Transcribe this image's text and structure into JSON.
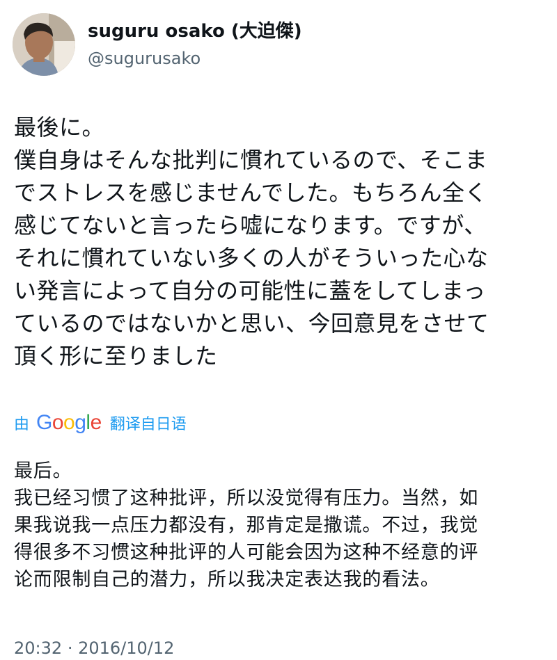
{
  "author": {
    "display_name": "suguru osako (大迫傑)",
    "handle": "@sugurusako",
    "avatar_icon": "profile-photo"
  },
  "tweet": {
    "text_original": "最後に。\n僕自身はそんな批判に慣れているので、そこまでストレスを感じませんでした。もちろん全く感じてないと言ったら嘘になります。ですが、それに慣れていない多くの人がそういった心ない発言によって自分の可能性に蓋をしてしまっているのではないかと思い、今回意見をさせて頂く形に至りました",
    "text_original_lines": [
      "最後に。",
      "僕自身はそんな批判に慣れているので、そこま",
      "でストレスを感じませんでした。もちろん全く",
      "感じてないと言ったら嘘になります。ですが、",
      "それに慣れていない多くの人がそういった心な",
      "い発言によって自分の可能性に蓋をしてしまっ",
      "ているのではないかと思い、今回意見をさせて",
      "頂く形に至りました"
    ],
    "translation_by": "由",
    "translation_provider": "Google",
    "translation_note": "翻译自日语",
    "text_translated_lines": [
      "最后。",
      "我已经习惯了这种批评，所以没觉得有压力。当然，如",
      "果我说我一点压力都没有，那肯定是撒谎。不过，我觉",
      "得很多不习惯这种批评的人可能会因为这种不经意的评",
      "论而限制自己的潜力，所以我决定表达我的看法。"
    ],
    "time": "20:32",
    "separator": "·",
    "date": "2016/10/12"
  },
  "colors": {
    "text": "#0f1419",
    "secondary": "#536471",
    "link": "#1d9bf0"
  }
}
